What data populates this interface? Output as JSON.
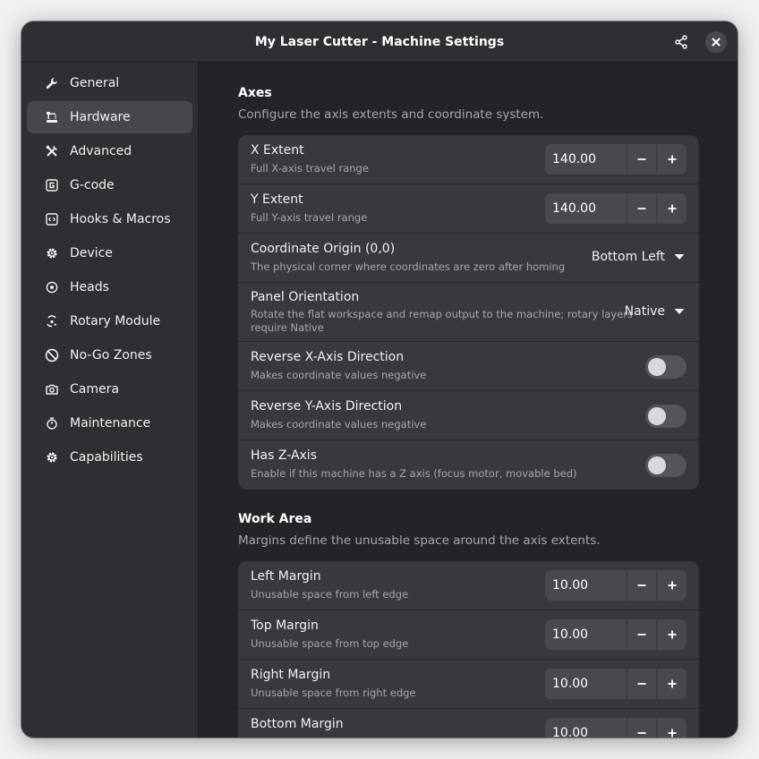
{
  "window": {
    "title": "My Laser Cutter - Machine Settings"
  },
  "icons": {
    "share": "share-icon",
    "close": "close-icon"
  },
  "sidebar": {
    "items": [
      {
        "label": "General",
        "icon": "wrench-icon",
        "active": false
      },
      {
        "label": "Hardware",
        "icon": "laser-icon",
        "active": true
      },
      {
        "label": "Advanced",
        "icon": "tools-icon",
        "active": false
      },
      {
        "label": "G-code",
        "icon": "gcode-icon",
        "active": false
      },
      {
        "label": "Hooks & Macros",
        "icon": "code-icon",
        "active": false
      },
      {
        "label": "Device",
        "icon": "gear-icon",
        "active": false
      },
      {
        "label": "Heads",
        "icon": "target-icon",
        "active": false
      },
      {
        "label": "Rotary Module",
        "icon": "rotary-icon",
        "active": false
      },
      {
        "label": "No-Go Zones",
        "icon": "prohibited-icon",
        "active": false
      },
      {
        "label": "Camera",
        "icon": "camera-icon",
        "active": false
      },
      {
        "label": "Maintenance",
        "icon": "timer-icon",
        "active": false
      },
      {
        "label": "Capabilities",
        "icon": "gear-icon",
        "active": false
      }
    ]
  },
  "axes": {
    "title": "Axes",
    "description": "Configure the axis extents and coordinate system.",
    "x_extent": {
      "title": "X Extent",
      "subtitle": "Full X-axis travel range",
      "value": "140.00"
    },
    "y_extent": {
      "title": "Y Extent",
      "subtitle": "Full Y-axis travel range",
      "value": "140.00"
    },
    "origin": {
      "title": "Coordinate Origin (0,0)",
      "subtitle": "The physical corner where coordinates are zero after homing",
      "value": "Bottom Left"
    },
    "orientation": {
      "title": "Panel Orientation",
      "subtitle_line1": "Rotate the flat workspace and remap output to the machine; rotary layers",
      "subtitle_line2": "require Native",
      "value": "Native"
    },
    "reverse_x": {
      "title": "Reverse X-Axis Direction",
      "subtitle": "Makes coordinate values negative",
      "on": false
    },
    "reverse_y": {
      "title": "Reverse Y-Axis Direction",
      "subtitle": "Makes coordinate values negative",
      "on": false
    },
    "has_z": {
      "title": "Has Z-Axis",
      "subtitle": "Enable if this machine has a Z axis (focus motor, movable bed)",
      "on": false
    }
  },
  "work_area": {
    "title": "Work Area",
    "description": "Margins define the unusable space around the axis extents.",
    "left": {
      "title": "Left Margin",
      "subtitle": "Unusable space from left edge",
      "value": "10.00"
    },
    "top": {
      "title": "Top Margin",
      "subtitle": "Unusable space from top edge",
      "value": "10.00"
    },
    "right": {
      "title": "Right Margin",
      "subtitle": "Unusable space from right edge",
      "value": "10.00"
    },
    "bottom": {
      "title": "Bottom Margin",
      "value": "10.00"
    }
  },
  "spin_labels": {
    "minus": "−",
    "plus": "+"
  }
}
